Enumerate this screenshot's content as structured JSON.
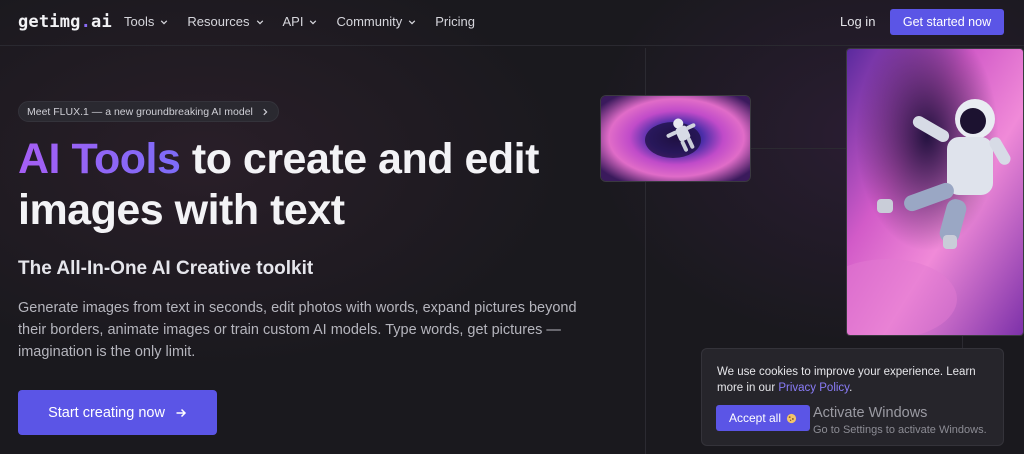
{
  "nav": {
    "logo_main": "getimg",
    "logo_dot": ".",
    "logo_tld": "ai",
    "items": [
      {
        "label": "Tools",
        "has_dropdown": true
      },
      {
        "label": "Resources",
        "has_dropdown": true
      },
      {
        "label": "API",
        "has_dropdown": true
      },
      {
        "label": "Community",
        "has_dropdown": true
      },
      {
        "label": "Pricing",
        "has_dropdown": false
      }
    ],
    "login": "Log in",
    "get_started": "Get started now"
  },
  "hero": {
    "pill": "Meet FLUX.1 — a new groundbreaking AI model",
    "headline_accent": "AI Tools",
    "headline_rest": " to create and edit images with text",
    "subtitle": "The All-In-One AI Creative toolkit",
    "description": "Generate images from text in seconds, edit photos with words, expand pictures beyond their borders, animate images or train custom AI models. Type words, get pictures — imagination is the only limit.",
    "cta": "Start creating now"
  },
  "cookie": {
    "text_before": "We use cookies to improve your experience. Learn more in our ",
    "link": "Privacy Policy",
    "text_after": ".",
    "accept": "Accept all"
  },
  "watermark": {
    "title": "Activate Windows",
    "subtitle": "Go to Settings to activate Windows."
  },
  "colors": {
    "accent": "#5b55e6",
    "background": "#1a191e",
    "link": "#8a7cf8"
  }
}
